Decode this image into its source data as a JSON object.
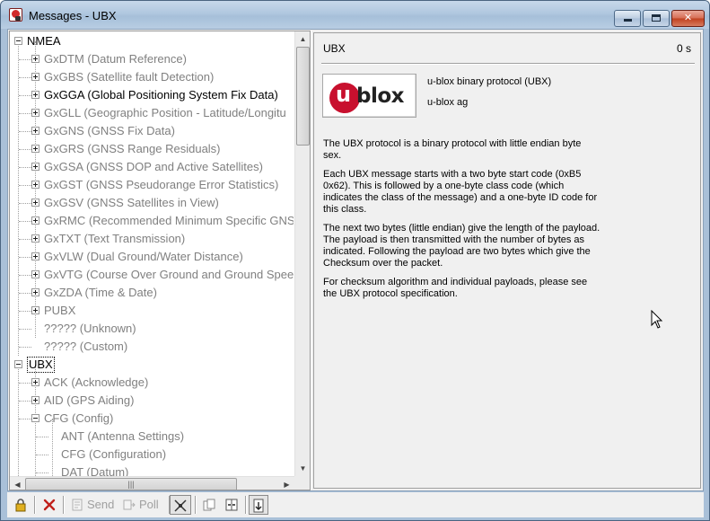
{
  "window": {
    "title": "Messages - UBX",
    "controls": {
      "minimize": "minimize",
      "maximize": "maximize",
      "close": "close"
    }
  },
  "tree": {
    "nodes": [
      {
        "label": "NMEA",
        "style": "dark",
        "expander": "minus"
      },
      {
        "label": "GxDTM (Datum Reference)",
        "style": "gray",
        "expander": "plus"
      },
      {
        "label": "GxGBS (Satellite fault Detection)",
        "style": "gray",
        "expander": "plus"
      },
      {
        "label": "GxGGA (Global Positioning System Fix Data)",
        "style": "dark",
        "expander": "plus"
      },
      {
        "label": "GxGLL (Geographic Position - Latitude/Longitu",
        "style": "gray",
        "expander": "plus"
      },
      {
        "label": "GxGNS (GNSS Fix Data)",
        "style": "gray",
        "expander": "plus"
      },
      {
        "label": "GxGRS (GNSS Range Residuals)",
        "style": "gray",
        "expander": "plus"
      },
      {
        "label": "GxGSA (GNSS DOP and Active Satellites)",
        "style": "gray",
        "expander": "plus"
      },
      {
        "label": "GxGST (GNSS Pseudorange Error Statistics)",
        "style": "gray",
        "expander": "plus"
      },
      {
        "label": "GxGSV (GNSS Satellites in View)",
        "style": "gray",
        "expander": "plus"
      },
      {
        "label": "GxRMC (Recommended Minimum Specific GNS",
        "style": "gray",
        "expander": "plus"
      },
      {
        "label": "GxTXT (Text Transmission)",
        "style": "gray",
        "expander": "plus"
      },
      {
        "label": "GxVLW (Dual Ground/Water Distance)",
        "style": "gray",
        "expander": "plus"
      },
      {
        "label": "GxVTG (Course Over Ground and Ground Spee",
        "style": "gray",
        "expander": "plus"
      },
      {
        "label": "GxZDA (Time & Date)",
        "style": "gray",
        "expander": "plus"
      },
      {
        "label": "PUBX",
        "style": "gray",
        "expander": "plus"
      },
      {
        "label": "????? (Unknown)",
        "style": "gray",
        "expander": "none"
      },
      {
        "label": "????? (Custom)",
        "style": "gray",
        "expander": "none"
      },
      {
        "label": "UBX",
        "style": "selected",
        "expander": "minus"
      },
      {
        "label": "ACK (Acknowledge)",
        "style": "gray",
        "expander": "plus"
      },
      {
        "label": "AID (GPS Aiding)",
        "style": "gray",
        "expander": "plus"
      },
      {
        "label": "CFG (Config)",
        "style": "gray",
        "expander": "minus"
      },
      {
        "label": "ANT (Antenna Settings)",
        "style": "gray",
        "expander": "none"
      },
      {
        "label": "CFG (Configuration)",
        "style": "gray",
        "expander": "none"
      },
      {
        "label": "DAT (Datum)",
        "style": "gray",
        "expander": "none"
      }
    ]
  },
  "detail": {
    "header_title": "UBX",
    "header_time": "0 s",
    "logo_text_u": "u",
    "logo_text_blox": "blox",
    "protocol_name": "u-blox binary protocol (UBX)",
    "vendor": "u-blox ag",
    "paragraphs": [
      "The UBX protocol is a binary protocol with little endian byte sex.",
      "Each UBX message starts with a two byte start code (0xB5 0x62). This is followed by a one-byte class code (which indicates the class of the message) and a one-byte ID code for this class.",
      "The next two bytes (little endian) give the length of the payload. The payload is then transmitted with the number of bytes as indicated. Following the payload are two bytes which give the Checksum over the packet.",
      "For checksum algorithm and individual payloads, please see the UBX protocol specification."
    ]
  },
  "toolbar": {
    "send_label": "Send",
    "poll_label": "Poll",
    "accent_lock": "#d4a017",
    "accent_delete": "#c0201a"
  }
}
